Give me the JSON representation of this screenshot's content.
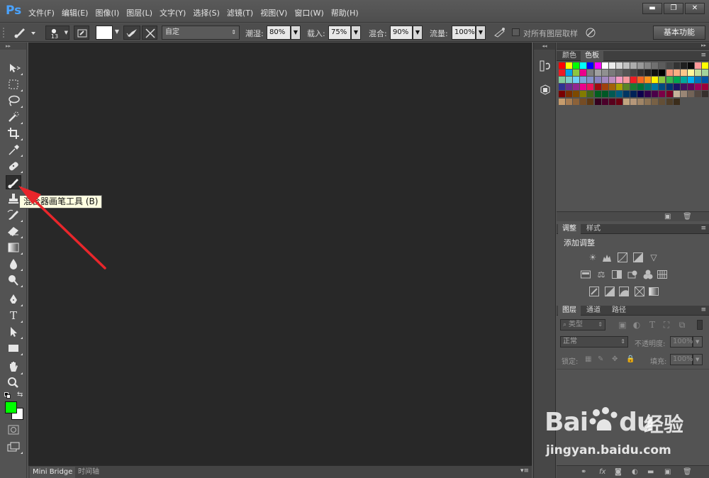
{
  "app": {
    "logo": "Ps"
  },
  "menu": [
    "文件(F)",
    "编辑(E)",
    "图像(I)",
    "图层(L)",
    "文字(Y)",
    "选择(S)",
    "滤镜(T)",
    "视图(V)",
    "窗口(W)",
    "帮助(H)"
  ],
  "window_controls": {
    "minimize": "▬",
    "maximize": "❐",
    "close": "✕"
  },
  "options": {
    "brush_size": "13",
    "preset": "自定",
    "wet_label": "潮湿:",
    "wet_value": "80%",
    "load_label": "载入:",
    "load_value": "75%",
    "mix_label": "混合:",
    "mix_value": "90%",
    "flow_label": "流量:",
    "flow_value": "100%",
    "sample_all_label": "对所有图层取样",
    "workspace": "基本功能"
  },
  "toolbar": {
    "collapse": "▸▸"
  },
  "tooltip": {
    "text": "混合器画笔工具 (B)"
  },
  "bottom_tabs": [
    "Mini Bridge",
    "时间轴"
  ],
  "colors": {
    "foreground": "#00ff00",
    "background": "#ffffff",
    "arrow": "#e8262b"
  },
  "panels": {
    "swatches": {
      "tabs": [
        "颜色",
        "色板"
      ]
    },
    "adjustments": {
      "tabs": [
        "调整",
        "样式"
      ],
      "title": "添加调整"
    },
    "layers": {
      "tabs": [
        "图层",
        "通道",
        "路径"
      ],
      "filter_label": "类型",
      "blend_mode": "正常",
      "opacity_label": "不透明度:",
      "opacity_value": "100%",
      "lock_label": "锁定:",
      "fill_label": "填充:",
      "fill_value": "100%"
    }
  },
  "watermark": {
    "brand": "Bai",
    "brand2": "du",
    "cn": "经验",
    "url": "jingyan.baidu.com"
  },
  "swatch_rows": [
    [
      "#ff0000",
      "#ffff00",
      "#00ff00",
      "#00ffff",
      "#0000ff",
      "#ff00ff",
      "#ffffff",
      "#ebebeb",
      "#d6d6d6",
      "#c2c2c2",
      "#adadad",
      "#999999",
      "#858585",
      "#707070",
      "#5c5c5c",
      "#474747",
      "#333333",
      "#1f1f1f",
      "#0a0a0a",
      "#ff9999",
      "#ffff00"
    ],
    [
      "#ed1c24",
      "#00a2e8",
      "#8cc63f",
      "#ec008c",
      "#808080",
      "#a0a0a0",
      "#909090",
      "#7a7a7a",
      "#686868",
      "#555555",
      "#444444",
      "#303030",
      "#202020",
      "#101010",
      "#000000",
      "#f7977a",
      "#fbad82",
      "#fdc68a",
      "#fff79a",
      "#c4df9b",
      "#a3d39c"
    ],
    [
      "#82ca9c",
      "#7accc8",
      "#6dcff6",
      "#7da7d9",
      "#8493ca",
      "#8882be",
      "#a187be",
      "#bc8dbf",
      "#f49ac2",
      "#f6989d",
      "#ed1c24",
      "#f26522",
      "#f7941d",
      "#fff200",
      "#8dc73f",
      "#39b54a",
      "#00a651",
      "#00a99d",
      "#00aeef",
      "#0072bc",
      "#0054a6"
    ],
    [
      "#2e3192",
      "#662d91",
      "#92278f",
      "#ec008c",
      "#ed145b",
      "#9e0b0f",
      "#a0410d",
      "#a36209",
      "#aba000",
      "#598527",
      "#197b30",
      "#007236",
      "#00746b",
      "#0076a3",
      "#004b80",
      "#003471",
      "#1b1464",
      "#440e62",
      "#630460",
      "#9e005d",
      "#9e0039"
    ],
    [
      "#790000",
      "#7b2e00",
      "#7d4900",
      "#827b00",
      "#406618",
      "#005e20",
      "#005826",
      "#005952",
      "#005b7f",
      "#003663",
      "#002157",
      "#0d004c",
      "#32004b",
      "#4b0049",
      "#7b0046",
      "#7a0026",
      "#c7b299",
      "#998675",
      "#736357",
      "#534741",
      "#37302d"
    ],
    [
      "#c69c6d",
      "#a67c52",
      "#8c6239",
      "#754c24",
      "#603913",
      "#35001e",
      "#4a002a",
      "#58001c",
      "#6b0010",
      "#c2a580",
      "#b5977a",
      "#a08566",
      "#8c7355",
      "#786145",
      "#634f36",
      "#4f3e28",
      "#3b2d1b"
    ]
  ]
}
